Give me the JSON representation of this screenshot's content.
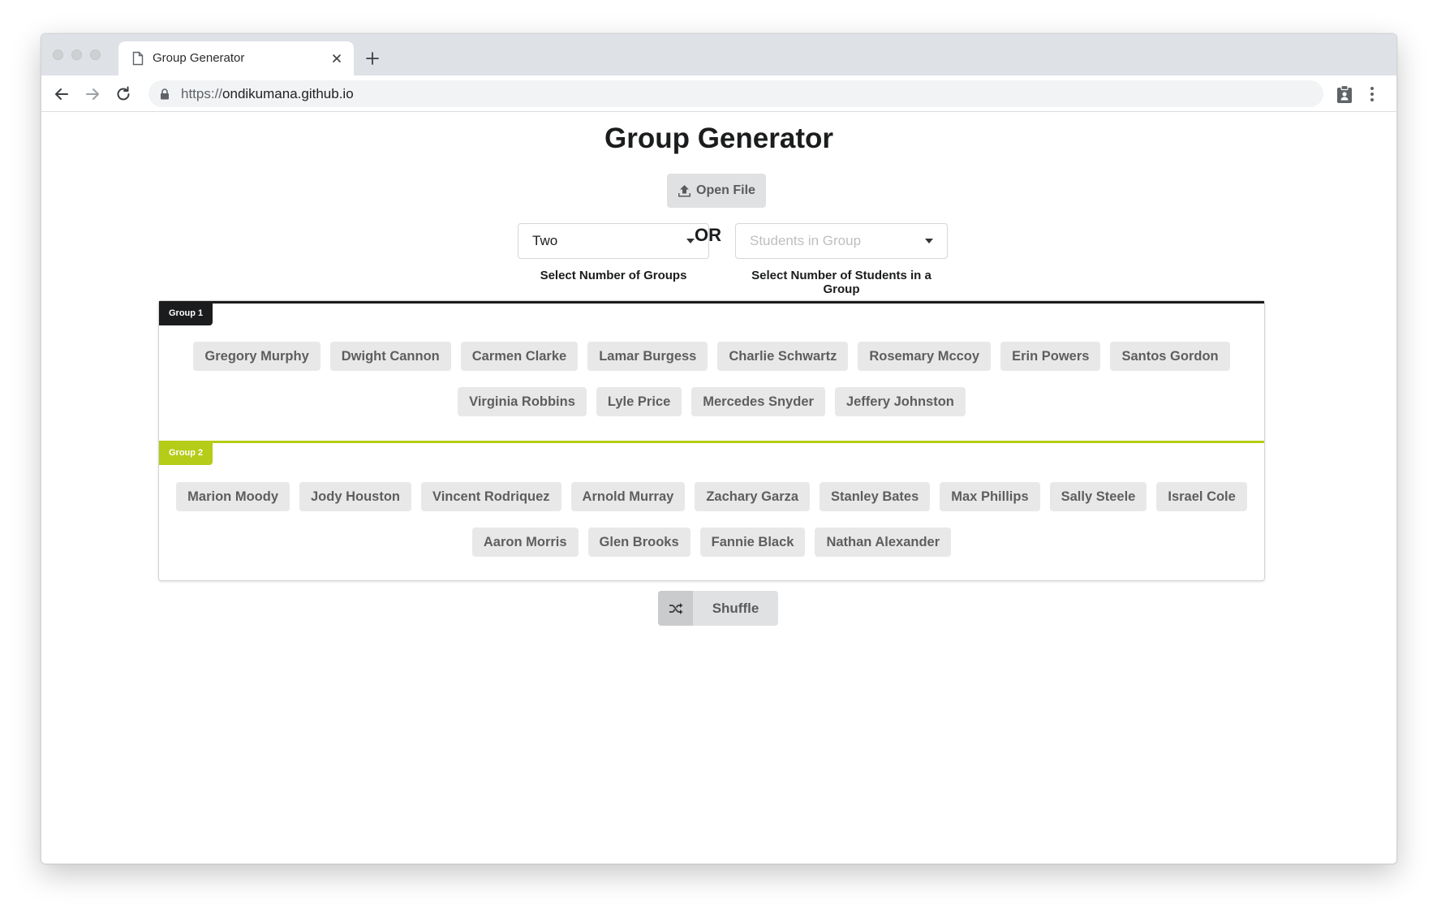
{
  "browser": {
    "tab_title": "Group Generator",
    "url_scheme": "https://",
    "url_host": "ondikumana.github.io"
  },
  "page": {
    "title": "Group Generator",
    "open_file_label": "Open File",
    "groups_dropdown_value": "Two",
    "groups_dropdown_label": "Select Number of Groups",
    "or_label": "OR",
    "students_dropdown_placeholder": "Students in Group",
    "students_dropdown_label": "Select Number of Students in a Group",
    "shuffle_label": "Shuffle"
  },
  "groups": [
    {
      "name": "Group 1",
      "color": "#1b1c1d",
      "rows": [
        [
          "Gregory Murphy",
          "Dwight Cannon",
          "Carmen Clarke",
          "Lamar Burgess",
          "Charlie Schwartz",
          "Rosemary Mccoy",
          "Erin Powers",
          "Santos Gordon"
        ],
        [
          "Virginia Robbins",
          "Lyle Price",
          "Mercedes Snyder",
          "Jeffery Johnston"
        ]
      ]
    },
    {
      "name": "Group 2",
      "color": "#b5cc18",
      "rows": [
        [
          "Marion Moody",
          "Jody Houston",
          "Vincent Rodriquez",
          "Arnold Murray",
          "Zachary Garza",
          "Stanley Bates",
          "Max Phillips",
          "Sally Steele",
          "Israel Cole"
        ],
        [
          "Aaron Morris",
          "Glen Brooks",
          "Fannie Black",
          "Nathan Alexander"
        ]
      ]
    }
  ],
  "colors": {
    "tab_strip": "#dee1e6",
    "button_gray": "#e0e1e2",
    "chip_gray": "#e8e8e8",
    "group1_accent": "#1b1c1d",
    "group2_accent": "#b5cc18"
  }
}
